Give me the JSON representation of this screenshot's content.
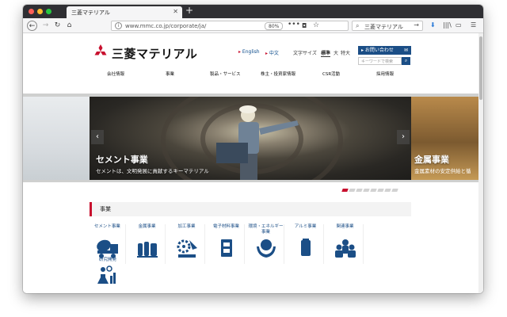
{
  "browser": {
    "tab_title": "三菱マテリアル",
    "tab_close": "✕",
    "new_tab": "+",
    "url": "www.mmc.co.jp/corporate/ja/",
    "zoom": "80%",
    "more": "•••",
    "search_value": "三菱マテリアル",
    "icons": [
      "back-icon",
      "forward-icon",
      "reload-icon",
      "home-icon",
      "info-icon",
      "pocket-icon",
      "star-icon",
      "search-icon",
      "download-icon",
      "library-icon",
      "sidebar-icon",
      "menu-icon"
    ]
  },
  "site": {
    "logo_text": "三菱マテリアル",
    "lang_en": "English",
    "lang_zh": "中文",
    "textsize_label": "文字サイズ",
    "textsize_std": "標準",
    "textsize_large": "大",
    "textsize_xlarge": "特大",
    "contact_label": "お問い合わせ",
    "search_placeholder": "キーワードで検索",
    "brand_color": "#c8102e",
    "accent_color": "#1b4e86"
  },
  "nav": {
    "items": [
      "会社情報",
      "事業",
      "製品・サービス",
      "株主・投資家情報",
      "CSR活動",
      "採用情報"
    ]
  },
  "hero": {
    "title": "セメント事業",
    "subtitle": "セメントは、文明発展に貢献するキーマテリアル",
    "next_title": "金属事業",
    "next_subtitle": "金属素材の安定供給と循",
    "prev_arrow": "‹",
    "next_arrow": "›",
    "slide_count": 8,
    "active_slide": 1
  },
  "business": {
    "section_title": "事業",
    "items": [
      {
        "label": "セメント事業",
        "icon": "cement-truck-icon"
      },
      {
        "label": "金属事業",
        "icon": "metal-ingot-icon"
      },
      {
        "label": "加工事業",
        "icon": "machining-tool-icon"
      },
      {
        "label": "電子材料事業",
        "icon": "electronic-chip-icon"
      },
      {
        "label": "環境・エネルギー事業",
        "icon": "globe-hands-icon"
      },
      {
        "label": "アルミ事業",
        "icon": "aluminum-can-icon"
      },
      {
        "label": "関連事業",
        "icon": "people-group-icon"
      }
    ],
    "extra": {
      "label": "研究開発",
      "icon": "research-lab-icon"
    }
  }
}
